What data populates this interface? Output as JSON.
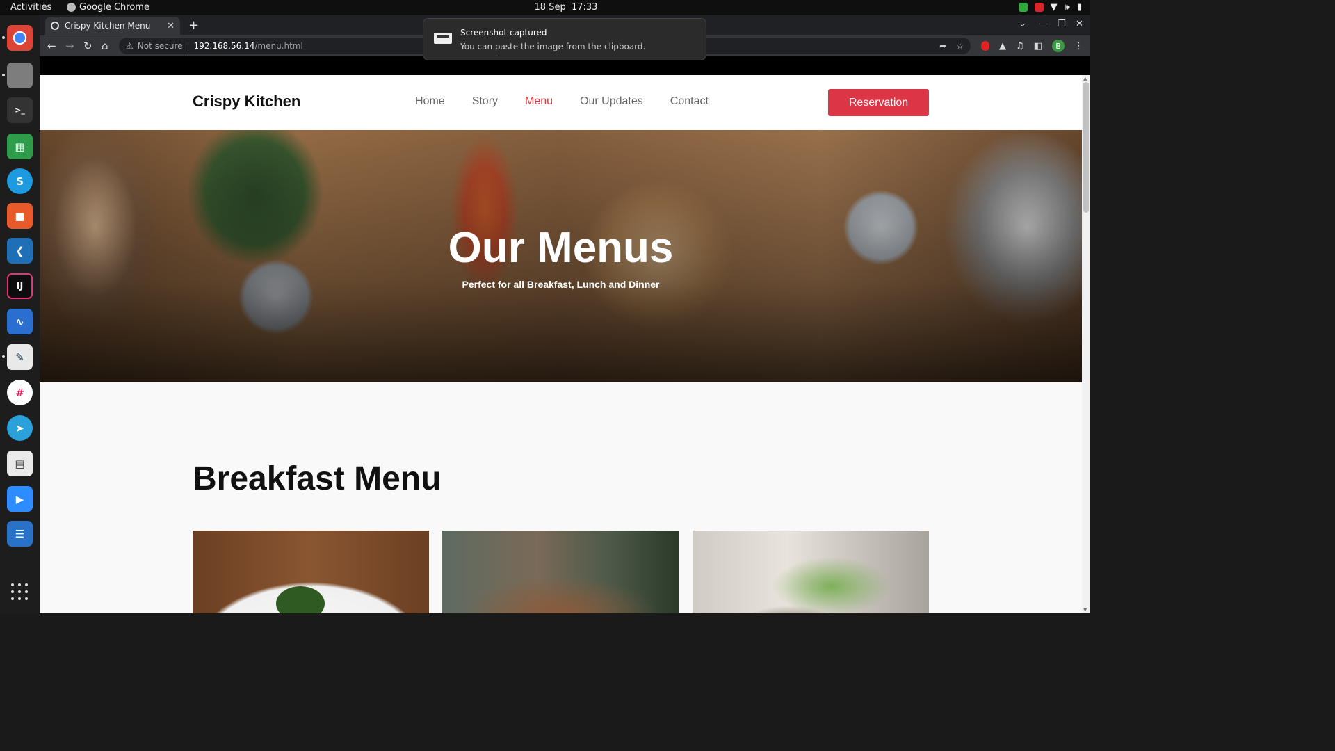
{
  "system": {
    "activities": "Activities",
    "app_name": "Google Chrome",
    "date": "18 Sep",
    "time": "17:33"
  },
  "dock": {
    "apps": [
      "chrome-icon",
      "files-icon",
      "terminal-icon",
      "spreadsheet-icon",
      "skype-icon",
      "software-icon",
      "vscode-icon",
      "intellij-icon",
      "monitor-icon",
      "text-editor-icon",
      "slack-icon",
      "telegram-icon",
      "reader-icon",
      "zoom-icon",
      "document-icon"
    ]
  },
  "browser": {
    "tab_title": "Crispy Kitchen Menu",
    "security_label": "Not secure",
    "url_host": "192.168.56.14",
    "url_path": "/menu.html",
    "profile_initial": "B"
  },
  "notification": {
    "title": "Screenshot captured",
    "body": "You can paste the image from the clipboard."
  },
  "site": {
    "brand": "Crispy Kitchen",
    "nav": [
      "Home",
      "Story",
      "Menu",
      "Our Updates",
      "Contact"
    ],
    "active_nav": "Menu",
    "reservation": "Reservation",
    "accent_color": "#dc3545",
    "hero_title": "Our Menus",
    "hero_subtitle": "Perfect for all Breakfast, Lunch and Dinner",
    "section_title": "Breakfast Menu"
  }
}
